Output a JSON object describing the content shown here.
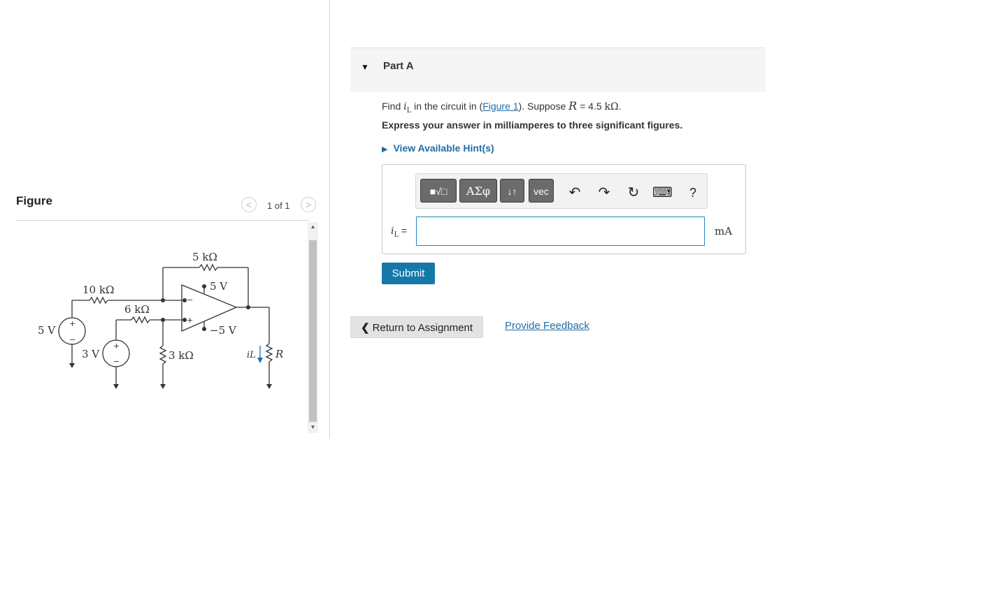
{
  "figure_panel": {
    "title": "Figure",
    "pager_text": "1 of 1",
    "prev_symbol": "<",
    "next_symbol": ">",
    "scroll_up_symbol": "▲",
    "scroll_down_symbol": "▼",
    "circuit_labels": {
      "r_top": "5 kΩ",
      "opamp_pos_supply": "5 V",
      "r_10k": "10 kΩ",
      "r_6k": "6 kΩ",
      "opamp_neg_supply": "−5 V",
      "src_5v": "5 V",
      "src_3v": "3 V",
      "r_3k": "3 kΩ",
      "current_symbol": "iL",
      "load_resistor": "R",
      "plus": "+",
      "minus": "−"
    }
  },
  "part": {
    "caret": "▼",
    "title": "Part A"
  },
  "question": {
    "prefix": "Find ",
    "var": "i",
    "var_sub": "L",
    "mid": " in the circuit in (",
    "figure_link": "Figure 1",
    "after_link": "). Suppose ",
    "r_var": "R",
    "r_value": " = 4.5 ",
    "r_unit": "kΩ",
    "end": ".",
    "instruction": "Express your answer in milliamperes to three significant figures.",
    "hints_caret": "▶",
    "hints_label": "View Available Hint(s)"
  },
  "toolbar": {
    "template_label": "■√□",
    "greek_label": "ΑΣφ",
    "updown_label": "↓↑",
    "vec_label": "vec",
    "undo_symbol": "↶",
    "redo_symbol": "↷",
    "reset_symbol": "↻",
    "keyboard_symbol": "⌨",
    "help_symbol": "?"
  },
  "answer": {
    "label_var": "i",
    "label_sub": "L",
    "label_eq": " =",
    "value": "",
    "unit": "mA"
  },
  "actions": {
    "submit_label": "Submit",
    "return_chevron": "❮",
    "return_label": "Return to Assignment",
    "feedback_label": "Provide Feedback"
  }
}
